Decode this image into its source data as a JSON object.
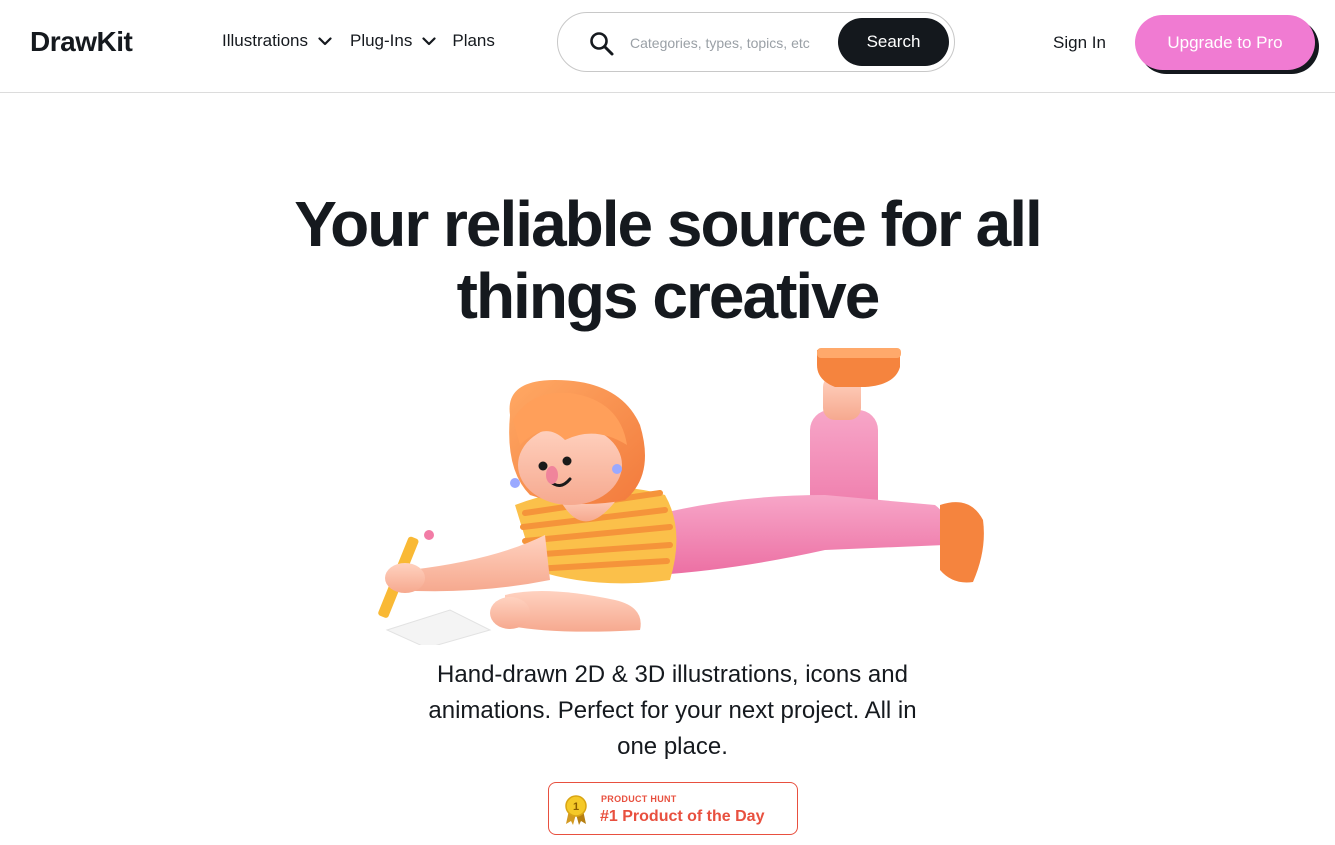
{
  "brand": {
    "name": "DrawKit"
  },
  "nav": {
    "items": [
      {
        "label": "Illustrations",
        "icon": "chevron-down-icon"
      },
      {
        "label": "Plug-Ins",
        "icon": "chevron-down-icon"
      },
      {
        "label": "Plans"
      }
    ]
  },
  "search": {
    "placeholder": "Categories, types, topics, etc",
    "value": "",
    "button_label": "Search",
    "icon": "search-icon"
  },
  "header_actions": {
    "signin_label": "Sign In",
    "upgrade_label": "Upgrade to Pro"
  },
  "hero": {
    "title_line1": "Your reliable source for all",
    "title_line2": "things creative",
    "subtitle": "Hand-drawn 2D & 3D illustrations, icons and animations. Perfect for your next project. All in one place."
  },
  "badge": {
    "eyebrow": "PRODUCT HUNT",
    "title": "#1 Product of the Day",
    "medal_number": "1",
    "icon": "medal-icon"
  },
  "colors": {
    "accent_pink": "#f07bd2",
    "dark": "#14181d",
    "badge_red": "#e8503f"
  }
}
